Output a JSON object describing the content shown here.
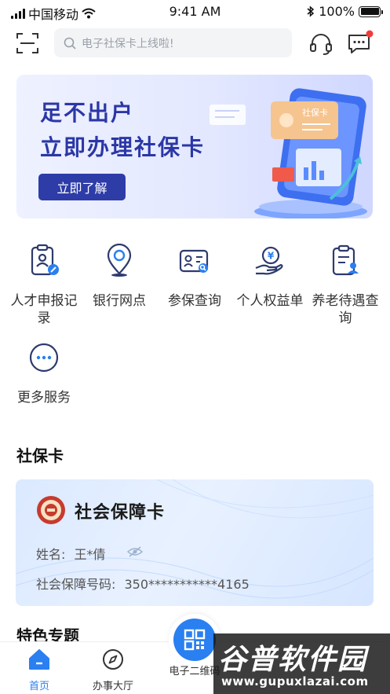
{
  "status_bar": {
    "carrier": "中国移动",
    "time": "9:41 AM",
    "battery": "100%"
  },
  "header": {
    "search_placeholder": "电子社保卡上线啦!"
  },
  "banner": {
    "line1": "足不出户",
    "line2": "立即办理社保卡",
    "button": "立即了解",
    "card_label": "社保卡"
  },
  "services": [
    {
      "label": "人才申报记录",
      "icon": "talent-report-icon"
    },
    {
      "label": "银行网点",
      "icon": "location-pin-icon"
    },
    {
      "label": "参保查询",
      "icon": "insurance-query-icon"
    },
    {
      "label": "个人权益单",
      "icon": "personal-rights-icon"
    },
    {
      "label": "养老待遇查询",
      "icon": "pension-query-icon"
    },
    {
      "label": "更多服务",
      "icon": "more-icon"
    }
  ],
  "sections": {
    "social_card": "社保卡",
    "featured": "特色专题"
  },
  "card": {
    "title": "社会保障卡",
    "name_label": "姓名:",
    "name_value": "王*倩",
    "number_label": "社会保障号码:",
    "number_value": "350***********4165"
  },
  "tabs": [
    {
      "label": "首页",
      "icon": "home-icon",
      "active": true
    },
    {
      "label": "办事大厅",
      "icon": "compass-icon",
      "active": false
    },
    {
      "label": "电子二维码",
      "icon": "qr-code-icon",
      "active": false
    }
  ],
  "watermark": {
    "title": "谷普软件园",
    "url": "www.gupuxlazai.com"
  },
  "colors": {
    "primary": "#2a7ff1",
    "banner_text": "#2b37a6",
    "badge": "#f23c3c"
  }
}
